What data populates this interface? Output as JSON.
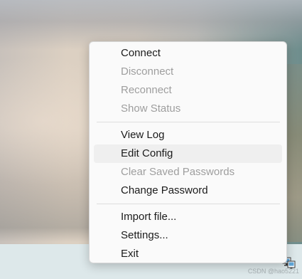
{
  "menu": {
    "items": [
      {
        "label": "Connect",
        "enabled": true
      },
      {
        "label": "Disconnect",
        "enabled": false
      },
      {
        "label": "Reconnect",
        "enabled": false
      },
      {
        "label": "Show Status",
        "enabled": false
      },
      {
        "label": "View Log",
        "enabled": true
      },
      {
        "label": "Edit Config",
        "enabled": true,
        "highlighted": true
      },
      {
        "label": "Clear Saved Passwords",
        "enabled": false
      },
      {
        "label": "Change Password",
        "enabled": true
      },
      {
        "label": "Import file...",
        "enabled": true
      },
      {
        "label": "Settings...",
        "enabled": true
      },
      {
        "label": "Exit",
        "enabled": true
      }
    ]
  },
  "taskbar": {
    "tray_icon": "network-adapter-icon",
    "watermark": "CSDN @hao5221"
  },
  "colors": {
    "menu_background": "#fafafa",
    "disabled_text": "#9e9e9e",
    "enabled_text": "#1b1b1b",
    "highlight": "#efefef",
    "taskbar": "#dde8ea"
  }
}
